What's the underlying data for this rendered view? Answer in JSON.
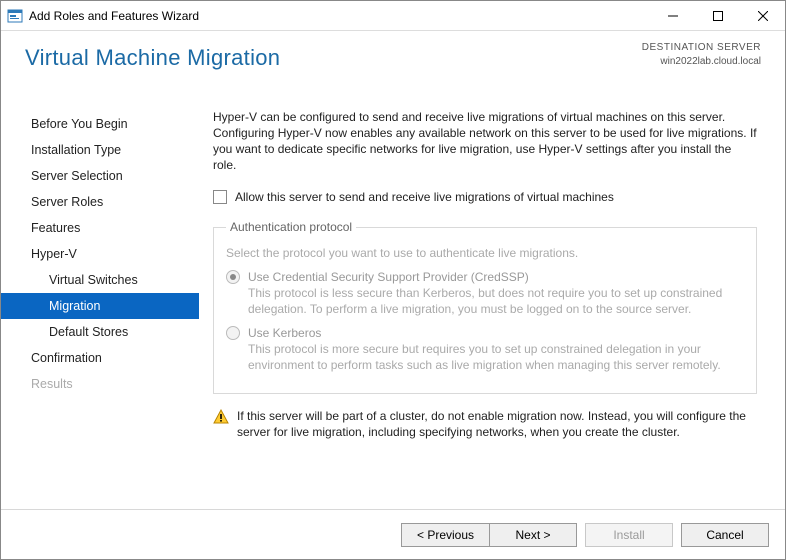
{
  "window": {
    "title": "Add Roles and Features Wizard"
  },
  "header": {
    "title": "Virtual Machine Migration",
    "destination_label": "DESTINATION SERVER",
    "destination_value": "win2022lab.cloud.local"
  },
  "sidebar": {
    "steps": [
      {
        "label": "Before You Begin",
        "child": false,
        "state": "normal"
      },
      {
        "label": "Installation Type",
        "child": false,
        "state": "normal"
      },
      {
        "label": "Server Selection",
        "child": false,
        "state": "normal"
      },
      {
        "label": "Server Roles",
        "child": false,
        "state": "normal"
      },
      {
        "label": "Features",
        "child": false,
        "state": "normal"
      },
      {
        "label": "Hyper-V",
        "child": false,
        "state": "normal"
      },
      {
        "label": "Virtual Switches",
        "child": true,
        "state": "normal"
      },
      {
        "label": "Migration",
        "child": true,
        "state": "active"
      },
      {
        "label": "Default Stores",
        "child": true,
        "state": "normal"
      },
      {
        "label": "Confirmation",
        "child": false,
        "state": "normal"
      },
      {
        "label": "Results",
        "child": false,
        "state": "disabled"
      }
    ]
  },
  "content": {
    "intro": "Hyper-V can be configured to send and receive live migrations of virtual machines on this server. Configuring Hyper-V now enables any available network on this server to be used for live migrations. If you want to dedicate specific networks for live migration, use Hyper-V settings after you install the role.",
    "checkbox_label": "Allow this server to send and receive live migrations of virtual machines",
    "auth": {
      "legend": "Authentication protocol",
      "subtext": "Select the protocol you want to use to authenticate live migrations.",
      "options": [
        {
          "label": "Use Credential Security Support Provider (CredSSP)",
          "desc": "This protocol is less secure than Kerberos, but does not require you to set up constrained delegation. To perform a live migration, you must be logged on to the source server.",
          "selected": true
        },
        {
          "label": "Use Kerberos",
          "desc": "This protocol is more secure but requires you to set up constrained delegation in your environment to perform tasks such as live migration when managing this server remotely.",
          "selected": false
        }
      ]
    },
    "warning": "If this server will be part of a cluster, do not enable migration now. Instead, you will configure the server for live migration, including specifying networks, when you create the cluster."
  },
  "footer": {
    "previous": "< Previous",
    "next": "Next >",
    "install": "Install",
    "cancel": "Cancel"
  }
}
